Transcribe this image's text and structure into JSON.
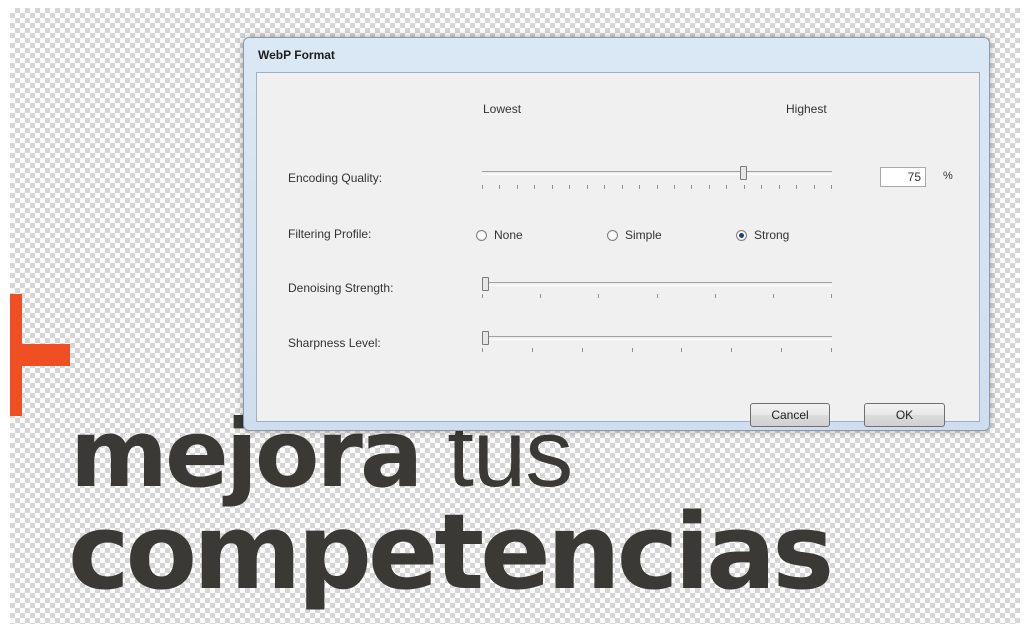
{
  "background": {
    "line1_bold": "mejora",
    "line1_light": "tus",
    "line2": "competencias",
    "accent_color": "#f04e23",
    "text_color": "#3b3935"
  },
  "dialog": {
    "title": "WebP Format",
    "quality_scale_low": "Lowest",
    "quality_scale_high": "Highest",
    "encoding_quality_label": "Encoding Quality:",
    "encoding_quality_value": "75",
    "encoding_quality_unit": "%",
    "encoding_quality_level": 0.75,
    "filtering_profile_label": "Filtering Profile:",
    "filtering_options": [
      {
        "label": "None",
        "selected": false
      },
      {
        "label": "Simple",
        "selected": false
      },
      {
        "label": "Strong",
        "selected": true
      }
    ],
    "denoising_label": "Denoising Strength:",
    "denoising_level": 0,
    "sharpness_label": "Sharpness Level:",
    "sharpness_level": 0,
    "cancel_label": "Cancel",
    "ok_label": "OK"
  }
}
